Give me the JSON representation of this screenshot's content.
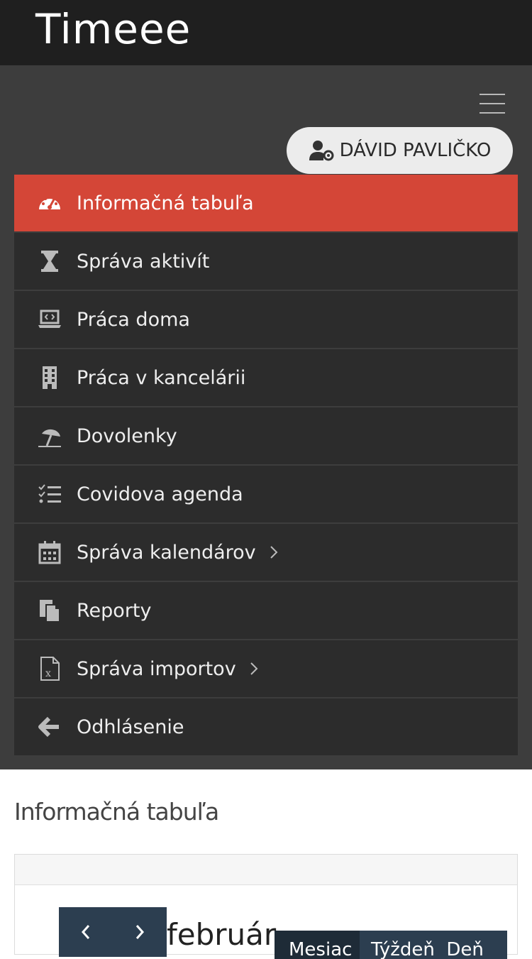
{
  "app": {
    "logo": "Timeee"
  },
  "header": {
    "user_name": "DÁVID PAVLIČKO"
  },
  "menu": {
    "items": [
      {
        "label": "Informačná tabuľa",
        "icon": "dashboard-gauge-icon",
        "active": true
      },
      {
        "label": "Správa aktivít",
        "icon": "hourglass-icon"
      },
      {
        "label": "Práca doma",
        "icon": "laptop-code-icon"
      },
      {
        "label": "Práca v kancelárii",
        "icon": "building-icon"
      },
      {
        "label": "Dovolenky",
        "icon": "beach-umbrella-icon"
      },
      {
        "label": "Covidova agenda",
        "icon": "checklist-icon"
      },
      {
        "label": "Správa kalendárov",
        "icon": "calendar-icon",
        "has_submenu": true
      },
      {
        "label": "Reporty",
        "icon": "copy-icon"
      },
      {
        "label": "Správa importov",
        "icon": "excel-file-icon",
        "has_submenu": true
      },
      {
        "label": "Odhlásenie",
        "icon": "arrow-left-icon"
      }
    ]
  },
  "main": {
    "title": "Informačná tabuľa",
    "calendar": {
      "month": "február",
      "view_buttons": [
        "Mesiac",
        "Týždeň",
        "Deň"
      ]
    }
  },
  "colors": {
    "topbar": "#1f1f1f",
    "nav_bg": "#3d3d3d",
    "menu_item_bg": "#2c2c2c",
    "active": "#d44637",
    "calendar_button": "#2c3e50"
  }
}
